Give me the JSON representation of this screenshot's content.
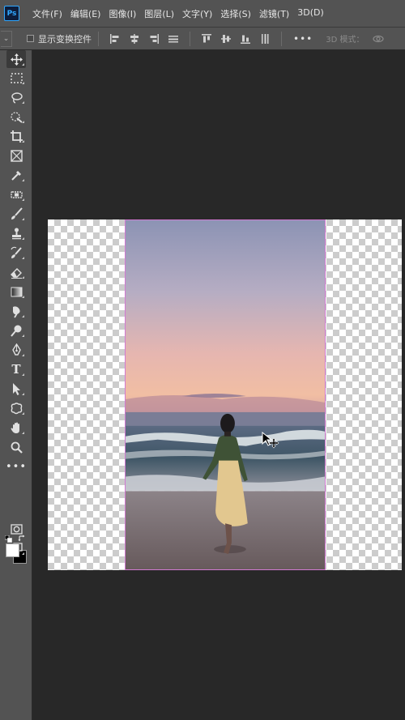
{
  "app": {
    "logo_text": "Ps"
  },
  "menu": {
    "items": [
      {
        "label": "文件(F)"
      },
      {
        "label": "编辑(E)"
      },
      {
        "label": "图像(I)"
      },
      {
        "label": "图层(L)"
      },
      {
        "label": "文字(Y)"
      },
      {
        "label": "选择(S)"
      },
      {
        "label": "滤镜(T)"
      },
      {
        "label": "3D(D)"
      }
    ]
  },
  "options": {
    "show_transform_label": "显示变换控件",
    "show_transform_checked": false,
    "more_label": "•••",
    "mode_3d_label": "3D 模式："
  },
  "toolbar": {
    "type_tool_glyph": "T",
    "more_tools_glyph": "•••",
    "foreground_color": "#ffffff",
    "background_color": "#000000"
  },
  "canvas": {
    "selection_border_color": "#d27ad2"
  }
}
